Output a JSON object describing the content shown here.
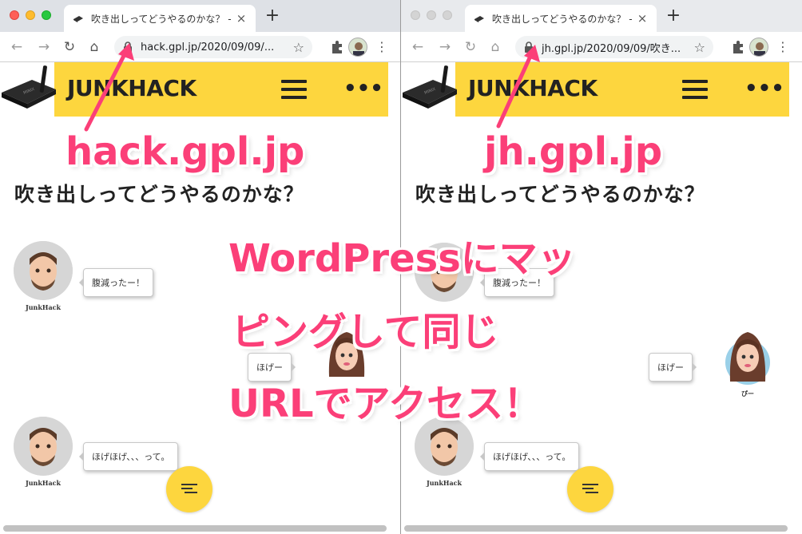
{
  "left_browser": {
    "tab_title": "吹き出しってどうやるのかな？ - ...",
    "url": "hack.gpl.jp/2020/09/09/...",
    "site_logo": "JUNKHACK",
    "post_title": "吹き出しってどうやるのかな？",
    "chats": [
      {
        "speaker": "JunkHack",
        "text": "腹減ったー！"
      },
      {
        "speaker": "",
        "text": "ほげー"
      },
      {
        "speaker": "JunkHack",
        "text": "ほげほげ、、、って。"
      }
    ]
  },
  "right_browser": {
    "tab_title": "吹き出しってどうやるのかな？ - ...",
    "url": "jh.gpl.jp/2020/09/09/吹き...",
    "site_logo": "JUNKHACK",
    "post_title": "吹き出しってどうやるのかな？",
    "chats": [
      {
        "speaker": "",
        "text": "腹減ったー！"
      },
      {
        "speaker": "ぴー",
        "text": "ほげー"
      },
      {
        "speaker": "JunkHack",
        "text": "ほげほげ、、、って。"
      }
    ]
  },
  "annotations": {
    "left_domain": "hack.gpl.jp",
    "right_domain": "jh.gpl.jp",
    "message_line1": "WordPressにマッ",
    "message_line2": "ピングして同じ",
    "message_line3": "URLでアクセス！",
    "color": "#fb3f78"
  },
  "colors": {
    "header_yellow": "#fdd63e",
    "overlay_pink": "#fb3f78"
  }
}
